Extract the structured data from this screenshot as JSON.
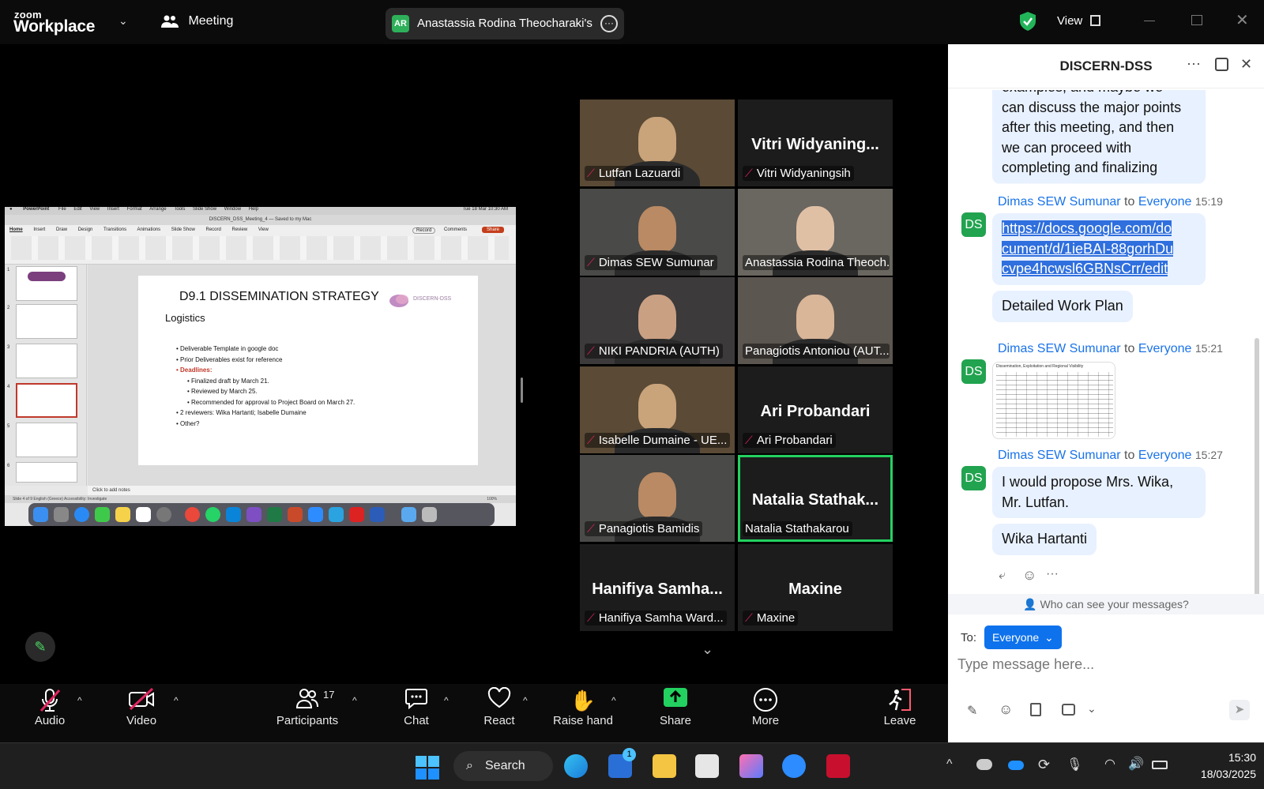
{
  "topbar": {
    "brand_small": "zoom",
    "brand_big": "Workplace",
    "meeting_label": "Meeting",
    "host_initials": "AR",
    "host_share_title": "Anastassia Rodina Theocharaki's",
    "view_label": "View"
  },
  "shared_screen": {
    "app_name": "PowerPoint",
    "menu": [
      "File",
      "Edit",
      "View",
      "Insert",
      "Format",
      "Arrange",
      "Tools",
      "Slide Show",
      "Window",
      "Help"
    ],
    "doc_title": "DISCERN_DSS_Meeting_4 — Saved to my Mac",
    "clock": "Tue 18 Mar 10:30 AM",
    "tabs": [
      "Home",
      "Insert",
      "Draw",
      "Design",
      "Transitions",
      "Animations",
      "Slide Show",
      "Record",
      "Review",
      "View"
    ],
    "record_label": "Record",
    "comments_label": "Comments",
    "share_label": "Share",
    "slide": {
      "title": "D9.1 DISSEMINATION STRATEGY",
      "subtitle": "Logistics",
      "logo_text": "DISCERN-DSS",
      "bullets": [
        "Deliverable Template in google doc",
        "Prior Deliverables exist for reference",
        "Deadlines:",
        "Finalized draft by March 21.",
        "Reviewed by March 25.",
        "Recommended for approval to Project Board on March 27.",
        "2 reviewers:  Wika Hartanti; Isabelle Dumaine",
        "Other?"
      ]
    },
    "notes_placeholder": "Click to add notes",
    "status_text": "Slide 4 of 9    English (Greece)    Accessibility: Investigate",
    "zoom_level": "100%"
  },
  "gallery": [
    {
      "display": "",
      "label": "Lutfan Lazuardi",
      "muted": true,
      "video": true
    },
    {
      "display": "Vitri  Widyaning...",
      "label": "Vitri Widyaningsih",
      "muted": true,
      "video": false
    },
    {
      "display": "",
      "label": "Dimas SEW Sumunar",
      "muted": true,
      "video": true
    },
    {
      "display": "",
      "label": "Anastassia Rodina Theoch...",
      "muted": false,
      "video": true
    },
    {
      "display": "",
      "label": "NIKI PANDRIA (AUTH)",
      "muted": true,
      "video": true
    },
    {
      "display": "",
      "label": "Panagiotis Antoniou (AUT...",
      "muted": false,
      "video": true
    },
    {
      "display": "",
      "label": "Isabelle Dumaine - UE...",
      "muted": true,
      "video": true
    },
    {
      "display": "Ari Probandari",
      "label": "Ari Probandari",
      "muted": true,
      "video": false
    },
    {
      "display": "",
      "label": "Panagiotis Bamidis",
      "muted": true,
      "video": true
    },
    {
      "display": "Natalia  Stathak...",
      "label": "Natalia Stathakarou",
      "muted": false,
      "video": false,
      "active": true
    },
    {
      "display": "Hanifiya  Samha...",
      "label": "Hanifiya Samha Ward...",
      "muted": true,
      "video": false
    },
    {
      "display": "Maxine",
      "label": "Maxine",
      "muted": true,
      "video": false
    }
  ],
  "toolbar": {
    "audio": "Audio",
    "video": "Video",
    "participants": "Participants",
    "participant_count": "17",
    "chat": "Chat",
    "react": "React",
    "raise_hand": "Raise hand",
    "share": "Share",
    "more": "More",
    "leave": "Leave"
  },
  "chat": {
    "title": "DISCERN-DSS",
    "partial_message": [
      "examples, and maybe we",
      "can discuss the major points",
      "after this meeting, and then",
      "we can proceed with",
      "completing and finalizing"
    ],
    "messages": [
      {
        "initials": "DS",
        "sender": "Dimas SEW Sumunar",
        "to": "to",
        "recipient": "Everyone",
        "time": "15:19",
        "link_lines": [
          "https://docs.google.com/do",
          "cument/d/1ieBAI-88gorhDu",
          "cvpe4hcwsl6GBNsCrr/edit"
        ],
        "followup": "Detailed Work Plan"
      },
      {
        "initials": "DS",
        "sender": "Dimas SEW Sumunar",
        "to": "to",
        "recipient": "Everyone",
        "time": "15:21",
        "image_caption": "Dissemination, Exploitation and Regional Visibility"
      },
      {
        "initials": "DS",
        "sender": "Dimas SEW Sumunar",
        "to": "to",
        "recipient": "Everyone",
        "time": "15:27",
        "lines": [
          "I would propose Mrs. Wika,",
          "Mr. Lutfan."
        ],
        "followup": "Wika Hartanti"
      }
    ],
    "who_can_see": "Who can see your messages?",
    "to_label": "To:",
    "to_value": "Everyone",
    "input_placeholder": "Type message here..."
  },
  "taskbar": {
    "search_label": "Search",
    "store_badge": "1",
    "time": "15:30",
    "date": "18/03/2025"
  },
  "colors": {
    "zoom_green": "#23d160",
    "mute_red": "#e0245e",
    "chat_bubble": "#e8f1ff",
    "link_blue": "#1a73e8",
    "everyone_chip": "#0e72ed"
  }
}
